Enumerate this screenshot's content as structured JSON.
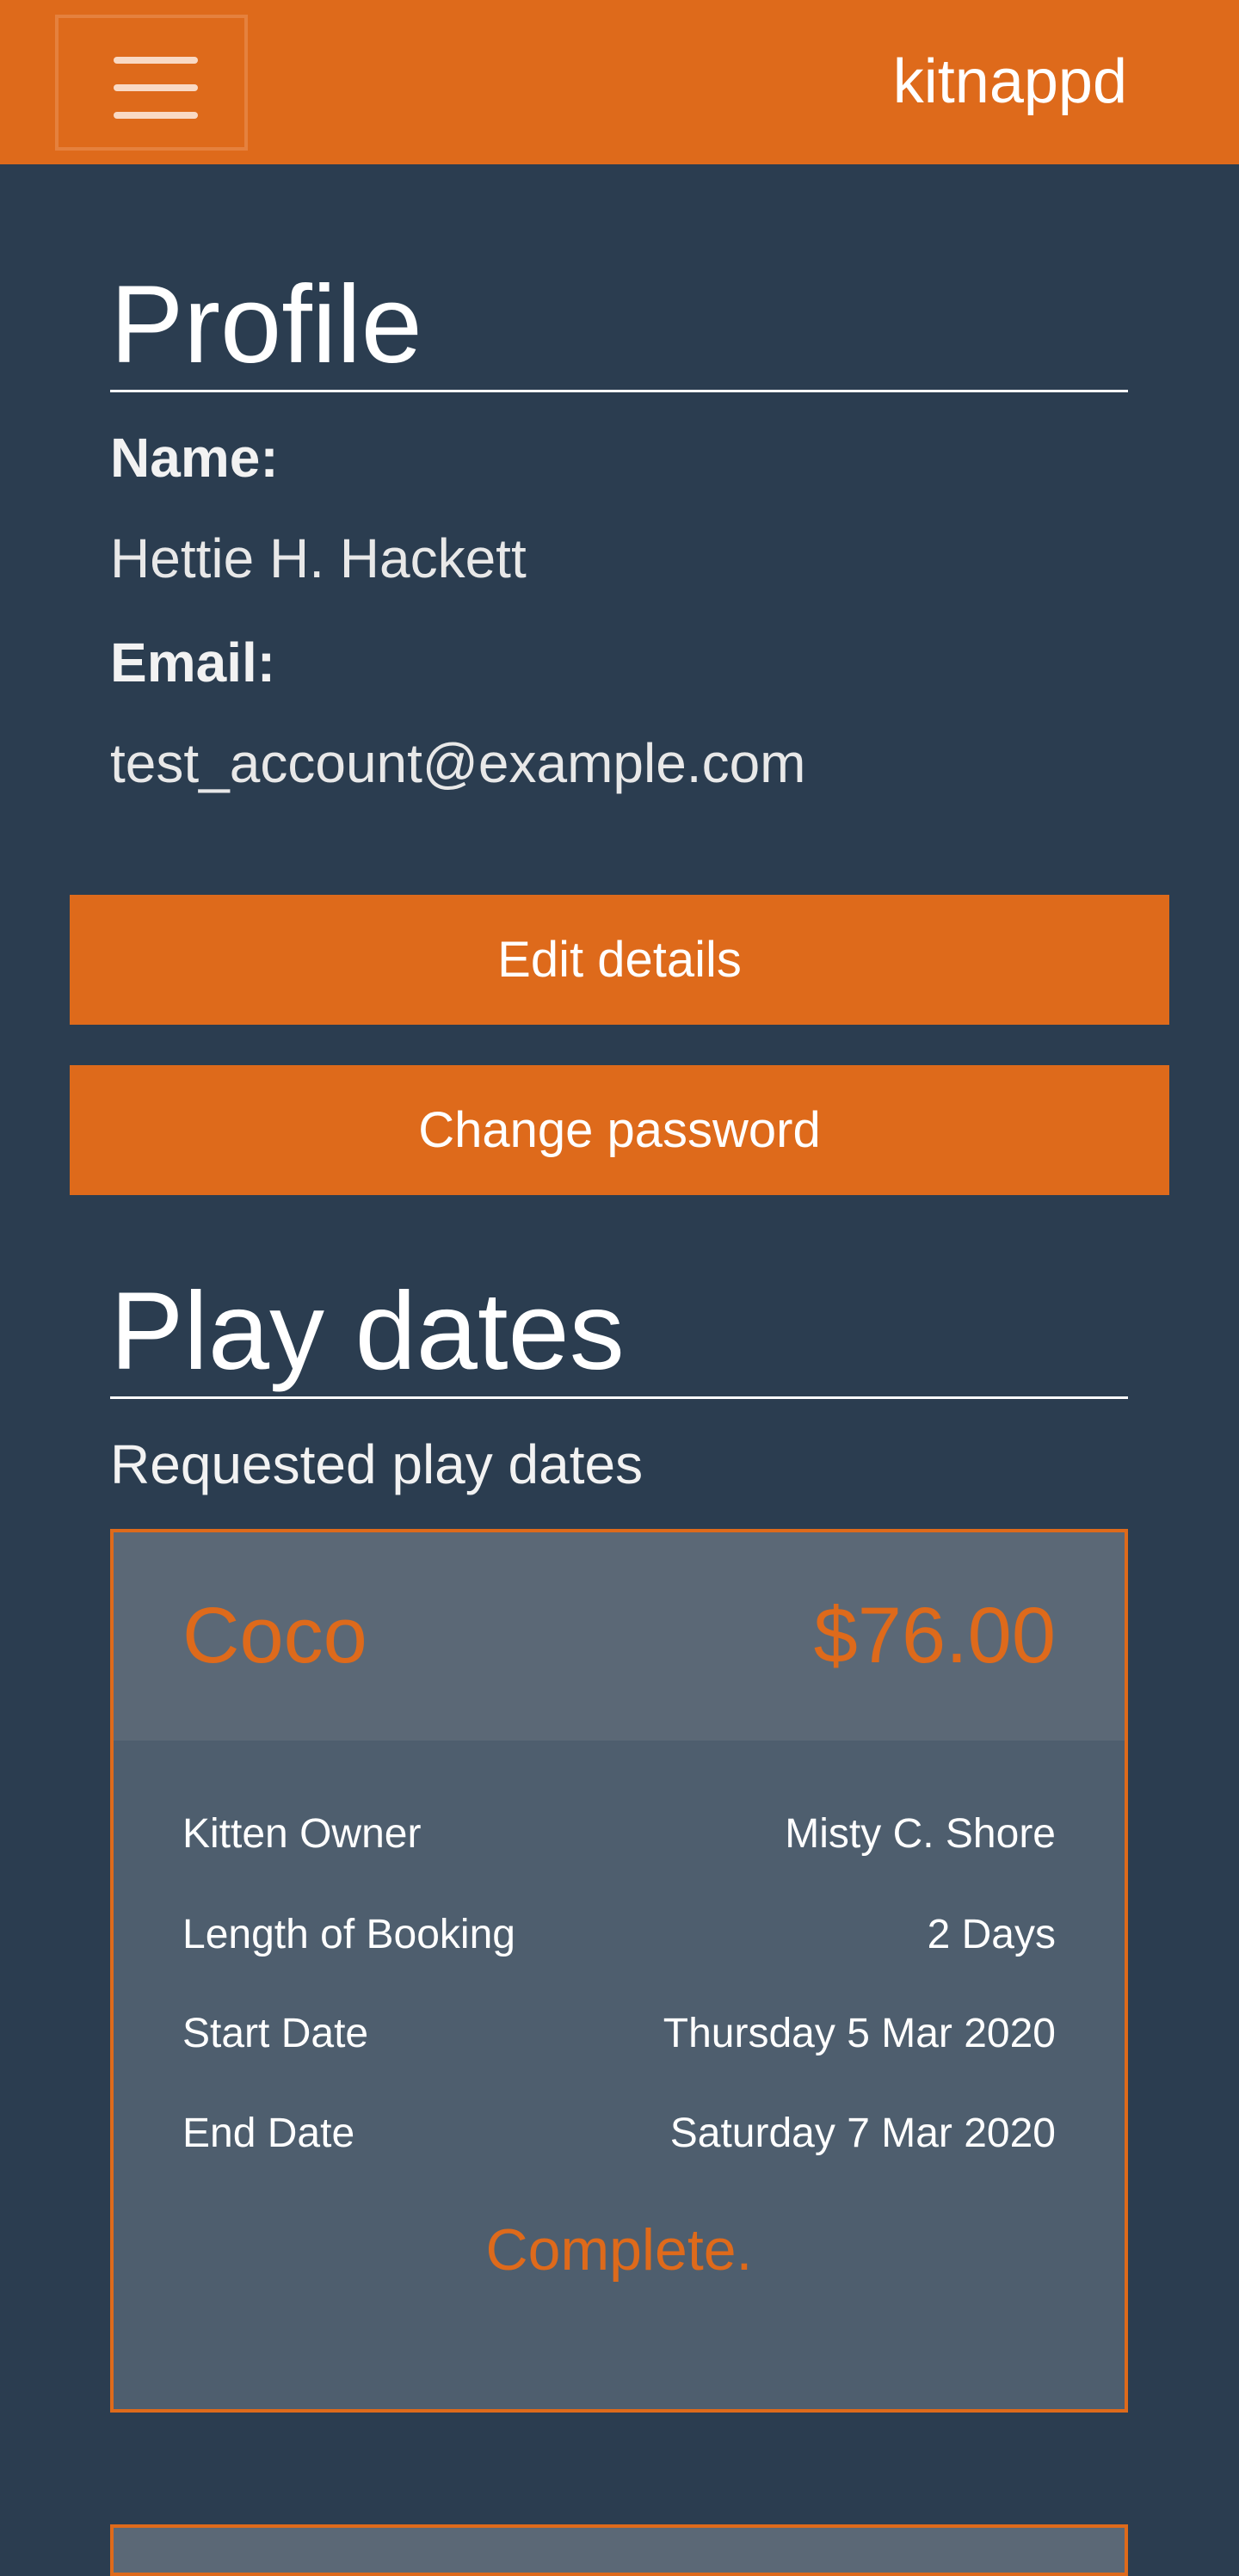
{
  "navbar": {
    "brand": "kitnappd",
    "menu_icon": "hamburger-icon",
    "color": "#de6a1b"
  },
  "profile": {
    "title": "Profile",
    "name_label": "Name:",
    "name_value": "Hettie H. Hackett",
    "email_label": "Email:",
    "email_value": "test_account@example.com",
    "edit_button": "Edit details",
    "password_button": "Change password"
  },
  "play_dates": {
    "title": "Play dates",
    "requested_heading": "Requested play dates",
    "cards": [
      {
        "kitten": "Coco",
        "price": "$76.00",
        "rows": [
          {
            "label": "Kitten Owner",
            "value": "Misty C. Shore"
          },
          {
            "label": "Length of Booking",
            "value": "2 Days"
          },
          {
            "label": "Start Date",
            "value": "Thursday 5 Mar 2020"
          },
          {
            "label": "End Date",
            "value": "Saturday 7 Mar 2020"
          }
        ],
        "status": "Complete."
      }
    ]
  }
}
